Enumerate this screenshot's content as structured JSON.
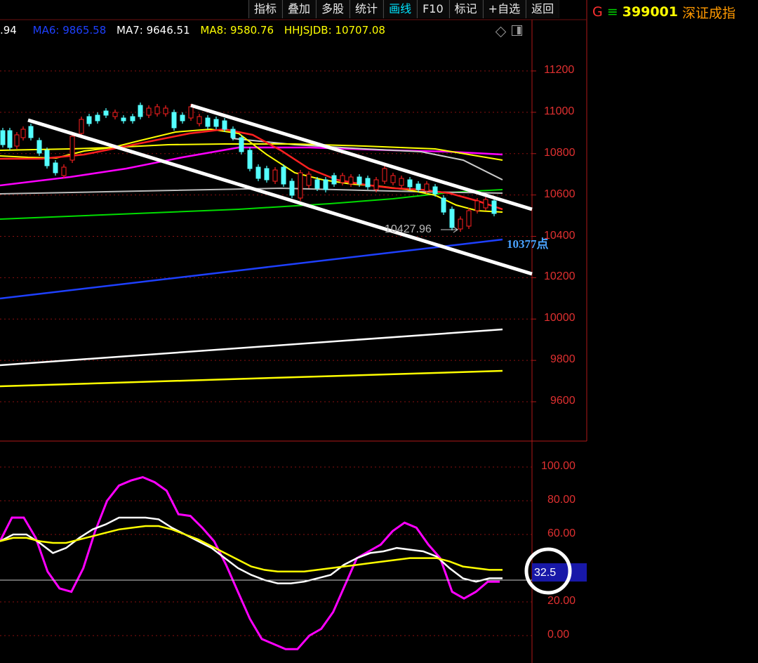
{
  "toolbar": {
    "buttons": [
      {
        "label": "指标"
      },
      {
        "label": "叠加"
      },
      {
        "label": "多股"
      },
      {
        "label": "统计"
      },
      {
        "label": "画线"
      },
      {
        "label": "F10"
      },
      {
        "label": "标记"
      },
      {
        "label": "+自选"
      },
      {
        "label": "返回"
      }
    ]
  },
  "stock": {
    "g_label": "G",
    "menu_icon": "hamburger-icon",
    "code": "399001",
    "name": "深证成指"
  },
  "ma_legend": {
    "first": ".94",
    "ma6": "MA6: 9865.58",
    "ma7": "MA7: 9646.51",
    "ma8": "MA8: 9580.76",
    "hhjsjdb": "HHJSJDB: 10707.08"
  },
  "annotations": {
    "low_price": "10427.96",
    "level": "10377点"
  },
  "colors": {
    "axis": "#e03030",
    "ma6": "#1e40ff",
    "ma7": "#ffffff",
    "ma8": "#ffff00",
    "hhjsjdb": "#ffff00",
    "highlight_text": "#4aa3ff",
    "osc_line1": "#ff00ff",
    "osc_line2": "#ffffff",
    "osc_line3": "#ffff00"
  },
  "chart_data": [
    {
      "type": "candlestick",
      "y_ticks": [
        "11200",
        "11000",
        "10800",
        "10600",
        "10400",
        "10200",
        "10000",
        "9800",
        "9600"
      ],
      "ylim": [
        9450,
        11400
      ],
      "grid": true,
      "annotations": [
        "10427.96",
        "10377点"
      ]
    },
    {
      "type": "line",
      "y_ticks": [
        "100.00",
        "80.00",
        "60.00",
        "20.00",
        "0.00"
      ],
      "ylim": [
        -5,
        110
      ],
      "current_value": "32.5",
      "series": [
        {
          "color": "#ff00ff",
          "values": [
            56,
            70,
            70,
            58,
            38,
            28,
            26,
            40,
            62,
            80,
            89,
            92,
            94,
            91,
            86,
            72,
            71,
            64,
            56,
            42,
            26,
            10,
            -2,
            -5,
            -8,
            -8,
            0,
            4,
            14,
            30,
            46,
            50,
            54,
            62,
            67,
            64,
            54,
            46,
            26,
            22,
            26,
            32,
            32
          ]
        },
        {
          "color": "#ffffff",
          "values": [
            56,
            60,
            60,
            55,
            49,
            52,
            58,
            63,
            66,
            70,
            70,
            70,
            69,
            64,
            60,
            56,
            52,
            46,
            40,
            36,
            33,
            31,
            31,
            32,
            34,
            36,
            42,
            46,
            49,
            50,
            52,
            51,
            50,
            47,
            40,
            34,
            32,
            34,
            34
          ]
        },
        {
          "color": "#ffff00",
          "values": [
            56,
            58,
            58,
            56,
            55,
            55,
            57,
            59,
            61,
            63,
            64,
            65,
            65,
            63,
            60,
            57,
            53,
            49,
            45,
            41,
            39,
            38,
            38,
            38,
            39,
            40,
            41,
            42,
            43,
            44,
            45,
            46,
            46,
            46,
            44,
            41,
            40,
            39,
            39
          ]
        }
      ]
    }
  ]
}
